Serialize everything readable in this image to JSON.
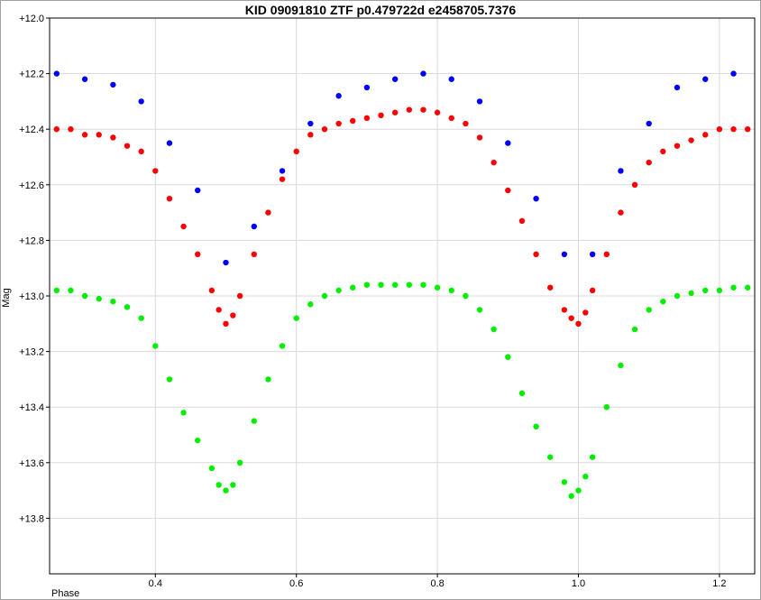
{
  "chart_data": {
    "type": "scatter",
    "title": "KID 09091810 ZTF p0.479722d e2458705.7376",
    "xlabel": "Phase",
    "ylabel": "Mag",
    "xlim": [
      0.25,
      1.25
    ],
    "ylim": [
      14.0,
      12.0
    ],
    "y_inverted": true,
    "grid": true,
    "legend": "none",
    "x_ticks": [
      0.4,
      0.6,
      0.8,
      1.0,
      1.2
    ],
    "x_tick_labels": [
      "0.4",
      "0.6",
      "0.8",
      "1.0",
      "1.2"
    ],
    "y_ticks": [
      12.0,
      12.2,
      12.4,
      12.6,
      12.8,
      13.0,
      13.2,
      13.4,
      13.6,
      13.8
    ],
    "y_tick_labels": [
      "+12.0",
      "+12.2",
      "+12.4",
      "+12.6",
      "+12.8",
      "+13.0",
      "+13.2",
      "+13.4",
      "+13.6",
      "+13.8"
    ],
    "series": [
      {
        "color": "#ff0000",
        "x": [
          0.26,
          0.28,
          0.3,
          0.32,
          0.34,
          0.36,
          0.38,
          0.4,
          0.42,
          0.44,
          0.46,
          0.48,
          0.49,
          0.5,
          0.51,
          0.52,
          0.54,
          0.56,
          0.58,
          0.6,
          0.62,
          0.64,
          0.66,
          0.68,
          0.7,
          0.72,
          0.74,
          0.76,
          0.78,
          0.8,
          0.82,
          0.84,
          0.86,
          0.88,
          0.9,
          0.92,
          0.94,
          0.96,
          0.98,
          0.99,
          1.0,
          1.01,
          1.02,
          1.04,
          1.06,
          1.08,
          1.1,
          1.12,
          1.14,
          1.16,
          1.18,
          1.2,
          1.22,
          1.24
        ],
        "y": [
          12.4,
          12.4,
          12.42,
          12.42,
          12.43,
          12.46,
          12.48,
          12.55,
          12.65,
          12.75,
          12.85,
          12.98,
          13.05,
          13.1,
          13.07,
          13.0,
          12.85,
          12.7,
          12.58,
          12.48,
          12.42,
          12.4,
          12.38,
          12.37,
          12.36,
          12.35,
          12.34,
          12.33,
          12.33,
          12.34,
          12.36,
          12.38,
          12.43,
          12.52,
          12.62,
          12.73,
          12.85,
          12.97,
          13.05,
          13.08,
          13.1,
          13.06,
          12.98,
          12.85,
          12.7,
          12.6,
          12.52,
          12.48,
          12.46,
          12.44,
          12.42,
          12.4,
          12.4,
          12.4
        ]
      },
      {
        "color": "#0000ff",
        "x": [
          0.26,
          0.3,
          0.34,
          0.38,
          0.42,
          0.46,
          0.5,
          0.54,
          0.58,
          0.62,
          0.66,
          0.7,
          0.74,
          0.78,
          0.82,
          0.86,
          0.9,
          0.94,
          0.98,
          1.02,
          1.06,
          1.1,
          1.14,
          1.18,
          1.22
        ],
        "y": [
          12.2,
          12.22,
          12.24,
          12.3,
          12.45,
          12.62,
          12.88,
          12.75,
          12.55,
          12.38,
          12.28,
          12.25,
          12.22,
          12.2,
          12.22,
          12.3,
          12.45,
          12.65,
          12.85,
          12.85,
          12.55,
          12.38,
          12.25,
          12.22,
          12.2
        ]
      },
      {
        "color": "#00ee00",
        "x": [
          0.26,
          0.28,
          0.3,
          0.32,
          0.34,
          0.36,
          0.38,
          0.4,
          0.42,
          0.44,
          0.46,
          0.48,
          0.49,
          0.5,
          0.51,
          0.52,
          0.54,
          0.56,
          0.58,
          0.6,
          0.62,
          0.64,
          0.66,
          0.68,
          0.7,
          0.72,
          0.74,
          0.76,
          0.78,
          0.8,
          0.82,
          0.84,
          0.86,
          0.88,
          0.9,
          0.92,
          0.94,
          0.96,
          0.98,
          0.99,
          1.0,
          1.01,
          1.02,
          1.04,
          1.06,
          1.08,
          1.1,
          1.12,
          1.14,
          1.16,
          1.18,
          1.2,
          1.22,
          1.24
        ],
        "y": [
          12.98,
          12.98,
          13.0,
          13.01,
          13.02,
          13.04,
          13.08,
          13.18,
          13.3,
          13.42,
          13.52,
          13.62,
          13.68,
          13.7,
          13.68,
          13.6,
          13.45,
          13.3,
          13.18,
          13.08,
          13.03,
          13.0,
          12.98,
          12.97,
          12.96,
          12.96,
          12.96,
          12.96,
          12.96,
          12.97,
          12.98,
          13.0,
          13.05,
          13.12,
          13.22,
          13.35,
          13.47,
          13.58,
          13.67,
          13.72,
          13.7,
          13.65,
          13.58,
          13.4,
          13.25,
          13.12,
          13.05,
          13.02,
          13.0,
          12.99,
          12.98,
          12.98,
          12.97,
          12.97
        ]
      }
    ]
  }
}
